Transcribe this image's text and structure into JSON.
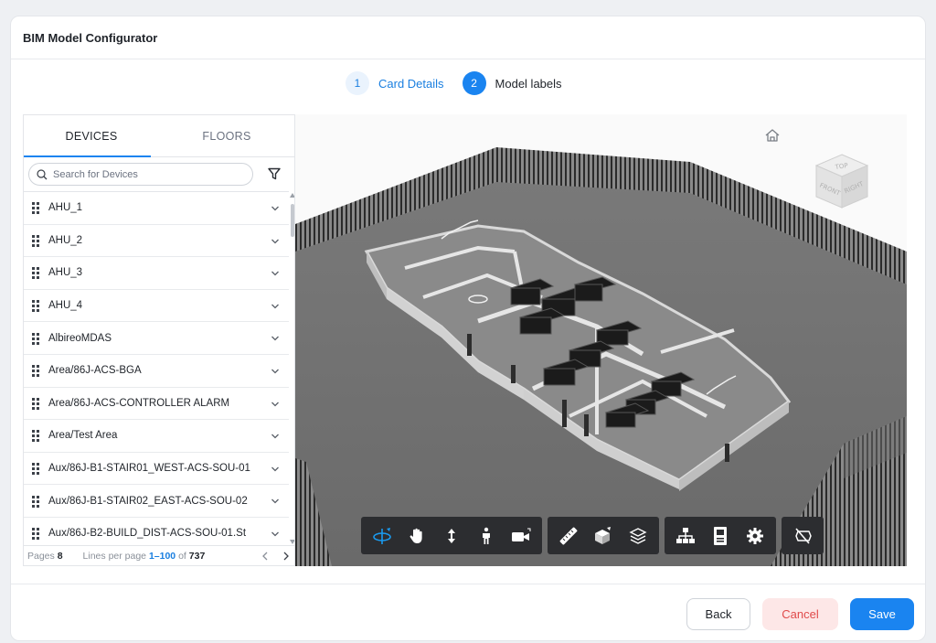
{
  "header": {
    "title": "BIM Model Configurator"
  },
  "stepper": {
    "steps": [
      {
        "num": "1",
        "label": "Card Details"
      },
      {
        "num": "2",
        "label": "Model labels"
      }
    ]
  },
  "tabs": {
    "devices": "DEVICES",
    "floors": "FLOORS"
  },
  "search": {
    "placeholder": "Search for Devices"
  },
  "devices": [
    {
      "label": "AHU_1"
    },
    {
      "label": "AHU_2"
    },
    {
      "label": "AHU_3"
    },
    {
      "label": "AHU_4"
    },
    {
      "label": "AlbireoMDAS"
    },
    {
      "label": "Area/86J-ACS-BGA"
    },
    {
      "label": "Area/86J-ACS-CONTROLLER ALARM"
    },
    {
      "label": "Area/Test Area"
    },
    {
      "label": "Aux/86J-B1-STAIR01_WEST-ACS-SOU-01"
    },
    {
      "label": "Aux/86J-B1-STAIR02_EAST-ACS-SOU-02"
    },
    {
      "label": "Aux/86J-B2-BUILD_DIST-ACS-SOU-01.St"
    }
  ],
  "pager": {
    "pages_label": "Pages",
    "pages_value": "8",
    "lines_label": "Lines per page",
    "range": "1–100",
    "of_label": "of",
    "total": "737"
  },
  "viewcube": {
    "top": "TOP",
    "front": "FRONT",
    "right": "RIGHT"
  },
  "toolbar": {
    "groups": [
      [
        "orbit-icon",
        "pan-icon",
        "dolly-icon",
        "first-person-icon",
        "camera-icon"
      ],
      [
        "measure-icon",
        "section-icon",
        "layers-icon"
      ],
      [
        "model-browser-icon",
        "properties-icon",
        "settings-icon"
      ],
      [
        "hide-icon"
      ]
    ]
  },
  "footer": {
    "back": "Back",
    "cancel": "Cancel",
    "save": "Save"
  },
  "colors": {
    "accent": "#1a84f0",
    "cancel_bg": "#fde7e7",
    "cancel_text": "#e04b4b",
    "toolbar_bg": "#2c2d30"
  }
}
